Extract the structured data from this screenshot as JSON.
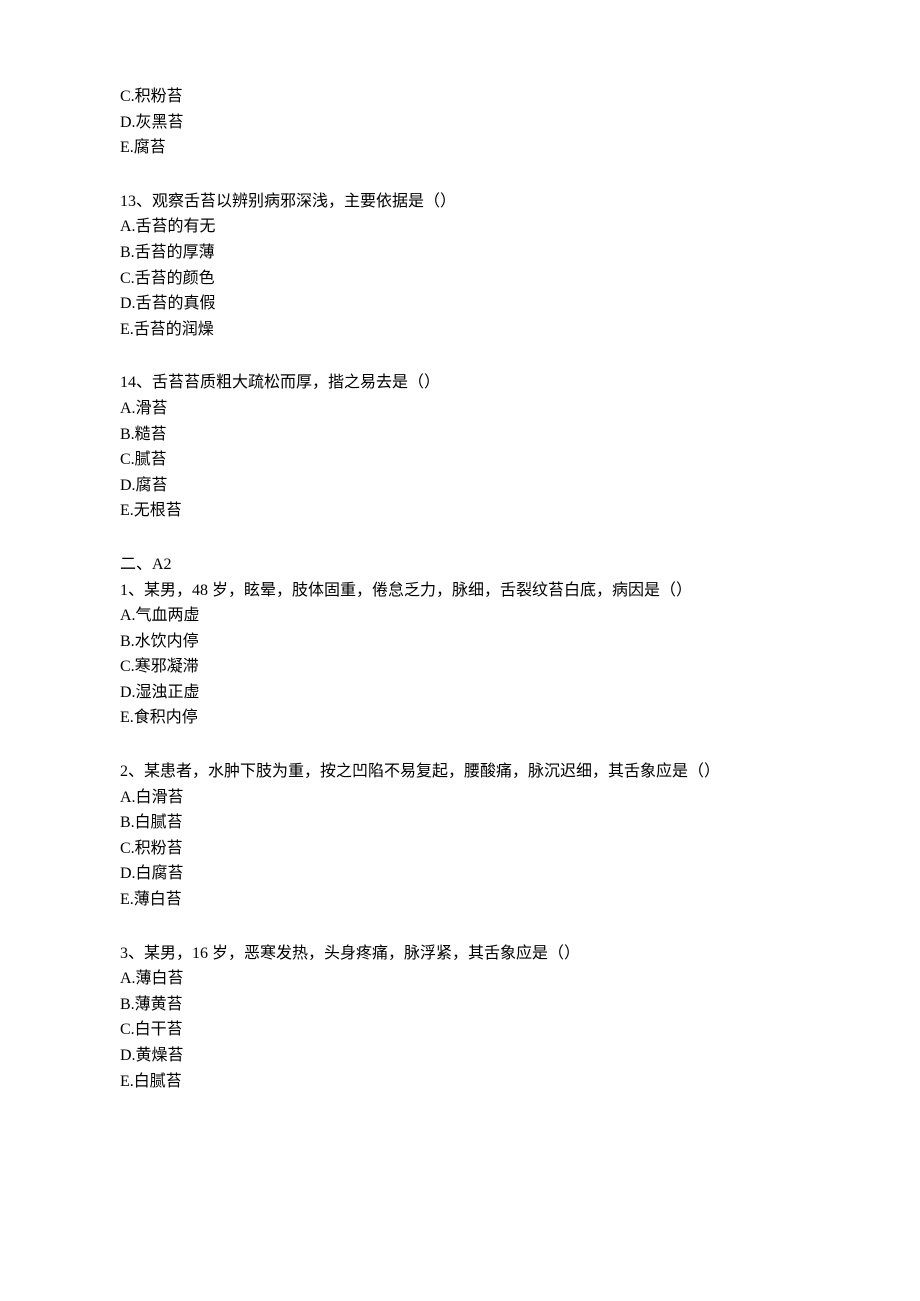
{
  "top_options": {
    "c": "C.积粉苔",
    "d": "D.灰黑苔",
    "e": "E.腐苔"
  },
  "q13": {
    "q": "13、观察舌苔以辨别病邪深浅，主要依据是（）",
    "a": "A.舌苔的有无",
    "b": "B.舌苔的厚薄",
    "c": "C.舌苔的颜色",
    "d": "D.舌苔的真假",
    "e": "E.舌苔的润燥"
  },
  "q14": {
    "q": "14、舌苔苔质粗大疏松而厚，揩之易去是（）",
    "a": "A.滑苔",
    "b": "B.糙苔",
    "c": "C.腻苔",
    "d": "D.腐苔",
    "e": "E.无根苔"
  },
  "section2": {
    "title": "二、A2",
    "q1": {
      "q": "1、某男，48 岁，眩晕，肢体固重，倦怠乏力，脉细，舌裂纹苔白底，病因是（）",
      "a": "A.气血两虚",
      "b": "B.水饮内停",
      "c": "C.寒邪凝滞",
      "d": "D.湿浊正虚",
      "e": "E.食积内停"
    },
    "q2": {
      "q": "2、某患者，水肿下肢为重，按之凹陷不易复起，腰酸痛，脉沉迟细，其舌象应是（）",
      "a": "A.白滑苔",
      "b": "B.白腻苔",
      "c": "C.积粉苔",
      "d": "D.白腐苔",
      "e": "E.薄白苔"
    },
    "q3": {
      "q": "3、某男，16 岁，恶寒发热，头身疼痛，脉浮紧，其舌象应是（）",
      "a": "A.薄白苔",
      "b": "B.薄黄苔",
      "c": "C.白干苔",
      "d": "D.黄燥苔",
      "e": "E.白腻苔"
    }
  }
}
